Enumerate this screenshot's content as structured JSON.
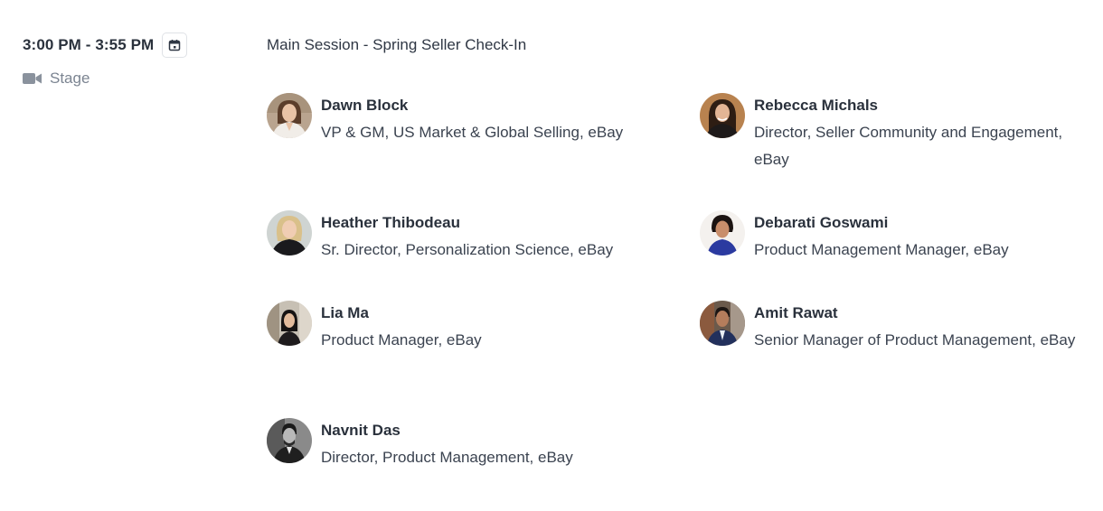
{
  "session": {
    "time": "3:00 PM - 3:55 PM",
    "location": "Stage",
    "title": "Main Session - Spring Seller Check-In"
  },
  "icons": {
    "calendar": "calendar-icon",
    "location": "video-camera-icon"
  },
  "speakers": [
    {
      "name": "Dawn Block",
      "role": "VP & GM, US Market & Global Selling, eBay"
    },
    {
      "name": "Rebecca Michals",
      "role": "Director, Seller Community and Engagement, eBay"
    },
    {
      "name": "Heather Thibodeau",
      "role": "Sr. Director, Personalization Science, eBay"
    },
    {
      "name": "Debarati Goswami",
      "role": "Product Management Manager, eBay"
    },
    {
      "name": "Lia Ma",
      "role": "Product Manager, eBay"
    },
    {
      "name": "Amit Rawat",
      "role": "Senior Manager of Product Management, eBay"
    },
    {
      "name": "Navnit Das",
      "role": "Director, Product Management, eBay"
    }
  ]
}
